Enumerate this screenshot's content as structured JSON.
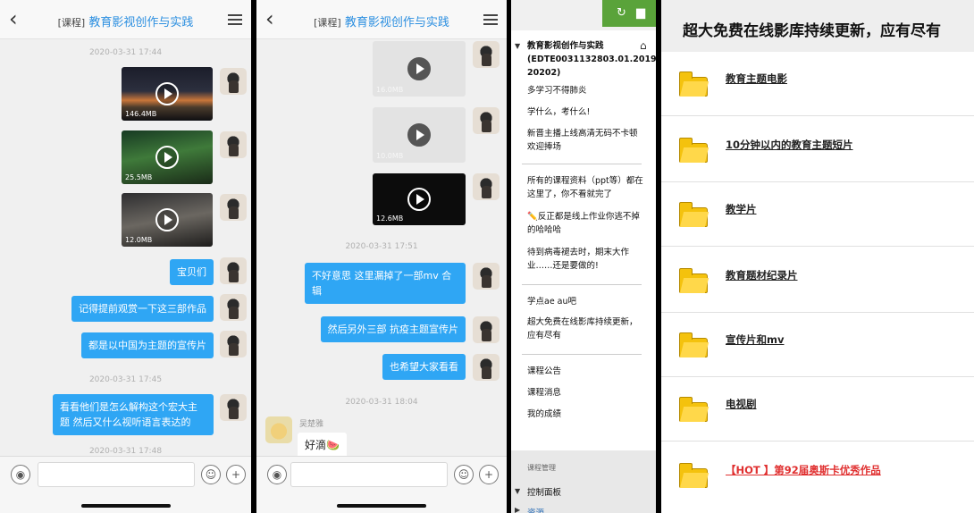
{
  "chat_header": {
    "tag": "[课程]",
    "course_name": "教育影视创作与实践"
  },
  "chat1": {
    "timestamps": [
      "2020-03-31 17:44",
      "2020-03-31 17:45",
      "2020-03-31 17:48"
    ],
    "videos": [
      {
        "size": "146.4MB"
      },
      {
        "size": "25.5MB"
      },
      {
        "size": "12.0MB"
      }
    ],
    "messages": [
      "宝贝们",
      "记得提前观赏一下这三部作品",
      "都是以中国为主题的宣传片",
      "看看他们是怎么解构这个宏大主题 然后又什么视听语言表达的"
    ]
  },
  "chat2": {
    "timestamps": [
      "2020-03-31 17:51",
      "2020-03-31 18:04"
    ],
    "videos": [
      {
        "size": "16.0MB"
      },
      {
        "size": "10.0MB"
      },
      {
        "size": "12.6MB"
      }
    ],
    "messages": [
      "不好意思 这里漏掉了一部mv 合辑",
      "然后另外三部 抗疫主题宣传片",
      "也希望大家看看"
    ],
    "incoming": {
      "sender": "吴楚雅",
      "text": "好滴🍉"
    }
  },
  "sidebar": {
    "course_title": "教育影视创作与实践(EDTE0031132803.01.2019-20202)",
    "items": [
      "多学习不得肺炎",
      "学什么，考什么!",
      "新晋主播上线高清无码不卡顿欢迎捧场",
      "所有的课程资料（ppt等）都在这里了，你不看就完了",
      "✏️反正都是线上作业你逃不掉的哈哈哈",
      "待到病毒褪去时，期末大作业……还是要做的!",
      "学点ae au吧",
      "超大免费在线影库持续更新，应有尽有",
      "课程公告",
      "课程消息",
      "我的成绩"
    ],
    "management_label": "课程管理",
    "control_panel": "控制面板",
    "resources": "资源"
  },
  "resources": {
    "title": "超大免费在线影库持续更新，应有尽有",
    "folders": [
      "教育主题电影",
      "10分钟以内的教育主题短片",
      "教学片",
      "教育题材纪录片",
      "宣传片和mv",
      "电视剧",
      "【HOT 】第92届奥斯卡优秀作品"
    ]
  },
  "colors": {
    "bubble_blue": "#2fa6f4",
    "sidebar_green": "#5aa33a",
    "hot_red": "#e03030"
  },
  "icons": [
    "back-icon",
    "menu-icon",
    "play-icon",
    "voice-icon",
    "emoji-icon",
    "plus-icon",
    "refresh-icon",
    "folder-icon",
    "home-icon"
  ]
}
